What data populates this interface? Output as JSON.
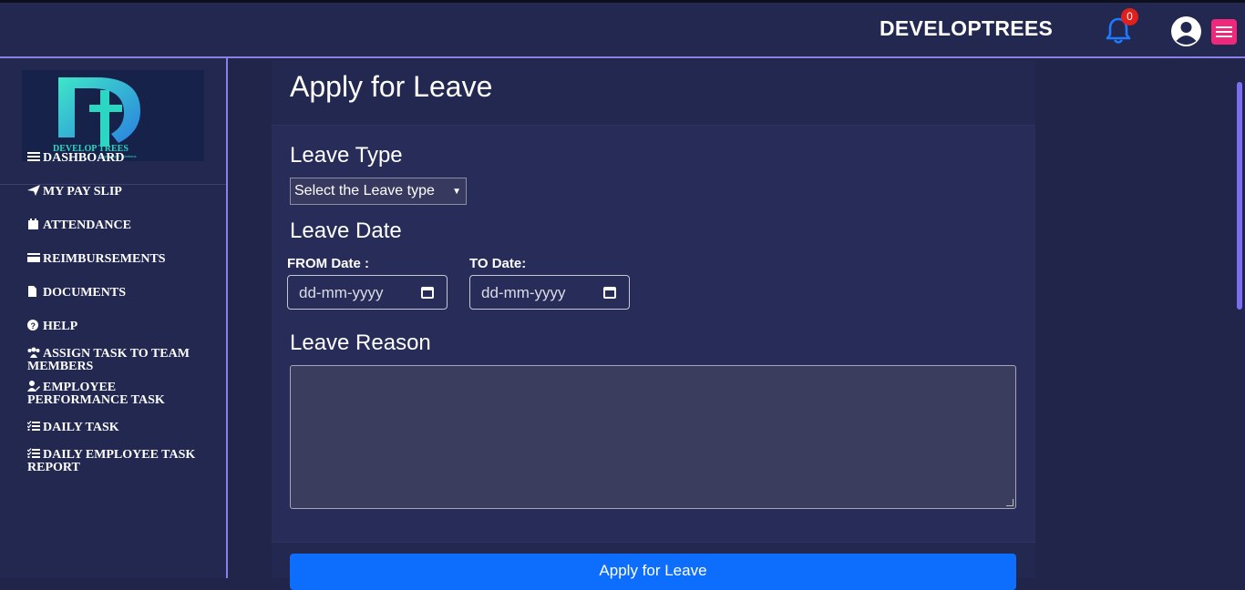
{
  "header": {
    "brand": "DEVELOPTREES",
    "notification_count": "0"
  },
  "logo": {
    "wordmark": "DEVELOP TREES",
    "tagline": "Simplifying IT Solutions"
  },
  "sidebar": {
    "items": [
      {
        "label": "DASHBOARD",
        "icon": "bars-icon"
      },
      {
        "label": "MY PAY SLIP",
        "icon": "paper-plane-icon"
      },
      {
        "label": "ATTENDANCE",
        "icon": "calendar-icon"
      },
      {
        "label": "REIMBURSEMENTS",
        "icon": "credit-card-icon"
      },
      {
        "label": "DOCUMENTS",
        "icon": "file-icon"
      },
      {
        "label": "HELP",
        "icon": "question-circle-icon"
      },
      {
        "label": "ASSIGN TASK TO TEAM MEMBERS",
        "icon": "users-icon"
      },
      {
        "label": "EMPLOYEE PERFORMANCE TASK",
        "icon": "user-edit-icon"
      },
      {
        "label": "DAILY TASK",
        "icon": "list-check-icon"
      },
      {
        "label": "DAILY EMPLOYEE TASK REPORT",
        "icon": "list-check-icon"
      }
    ]
  },
  "form": {
    "title": "Apply for Leave",
    "leave_type_label": "Leave Type",
    "leave_type_select": "Select the Leave type",
    "leave_date_label": "Leave Date",
    "from_label": "FROM Date :",
    "to_label": "TO Date:",
    "from_placeholder": "dd-mm-yyyy",
    "to_placeholder": "dd-mm-yyyy",
    "reason_label": "Leave Reason",
    "reason_value": "",
    "submit_label": "Apply for Leave"
  },
  "colors": {
    "page_bg": "#21254a",
    "card_bg": "#272c58",
    "accent": "#0d6efd",
    "border_accent": "#8b7fe8",
    "badge": "#e0201c",
    "menu_button": "#f0287c"
  }
}
